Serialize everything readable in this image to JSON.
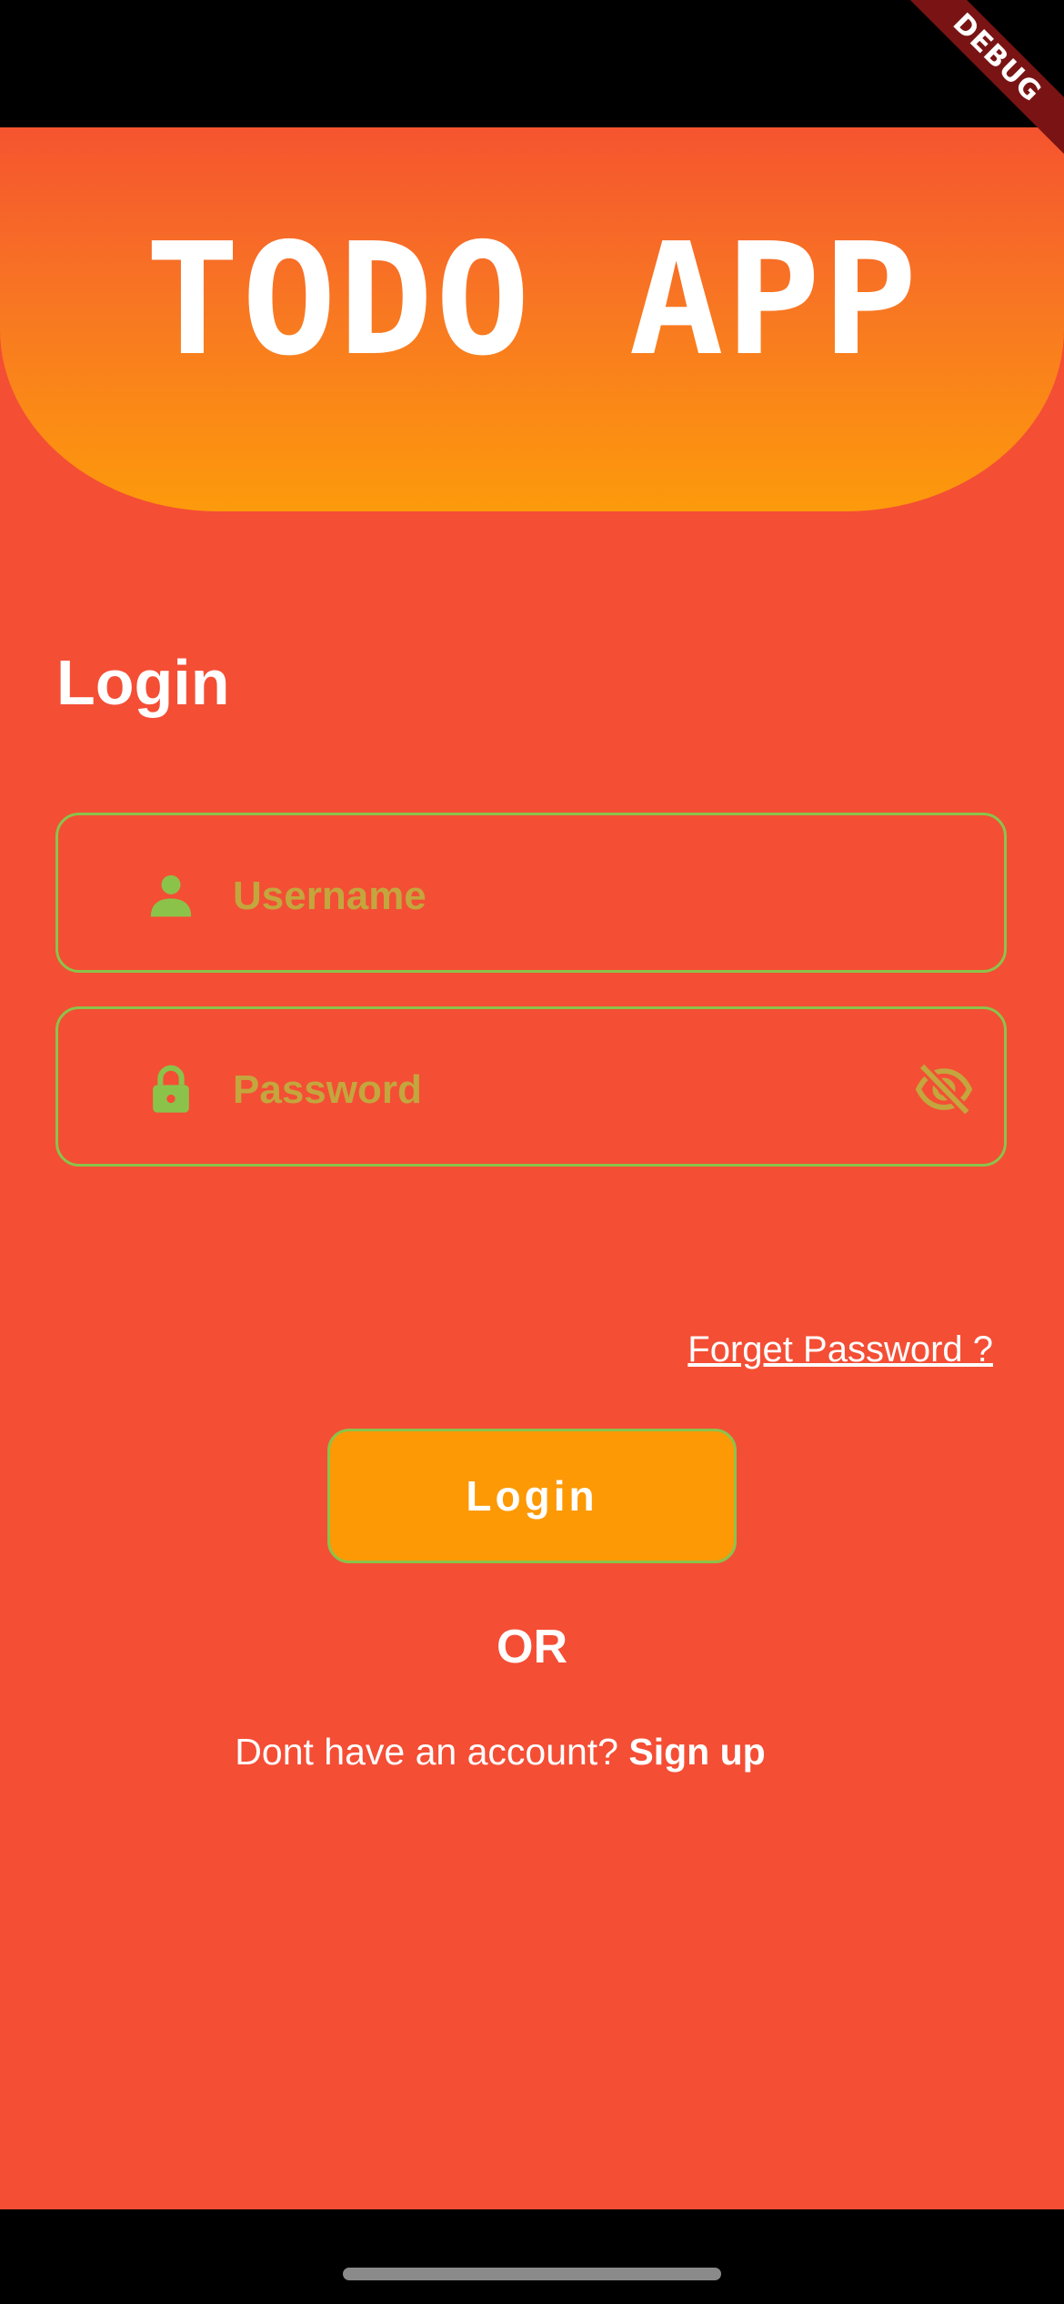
{
  "debug_banner": {
    "label": "DEBUG"
  },
  "header": {
    "logo_text": "TODO APP"
  },
  "login": {
    "title": "Login",
    "username": {
      "placeholder": "Username",
      "value": "",
      "icon": "person-icon"
    },
    "password": {
      "placeholder": "Password",
      "value": "",
      "icon": "lock-icon",
      "toggle_icon": "eye-off-icon"
    },
    "forget_password": "Forget Password ?",
    "button_label": "Login",
    "or_text": "OR",
    "signup_prompt": "Dont have an account? ",
    "signup_link": "Sign up"
  },
  "colors": {
    "background": "#f44e35",
    "header_gradient_top": "#f5542f",
    "header_gradient_bottom": "#fd9a0b",
    "accent_green": "#8bc34a",
    "placeholder": "#c3a63d",
    "button": "#fd9905"
  }
}
